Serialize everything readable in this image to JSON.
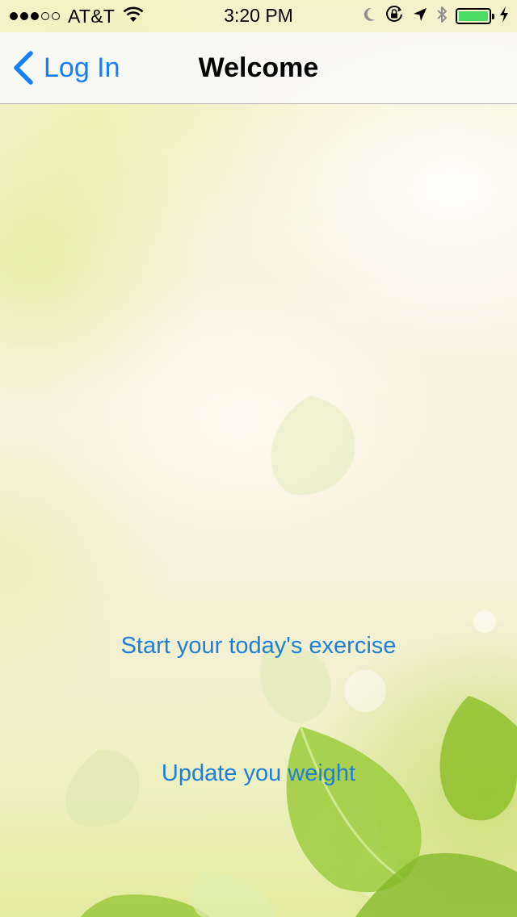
{
  "status_bar": {
    "signal_bars_filled": 3,
    "signal_bars_total": 5,
    "carrier": "AT&T",
    "time": "3:20 PM",
    "battery_level": 1.0,
    "battery_color": "#4cd964",
    "icons": [
      "wifi-icon",
      "moon-icon",
      "orientation-lock-icon",
      "location-arrow-icon",
      "bluetooth-icon",
      "battery-icon",
      "charging-bolt-icon"
    ]
  },
  "nav": {
    "back_label": "Log In",
    "title": "Welcome",
    "accent_color": "#157efb"
  },
  "actions": {
    "start_exercise": "Start your today's exercise",
    "update_weight": "Update you weight"
  }
}
